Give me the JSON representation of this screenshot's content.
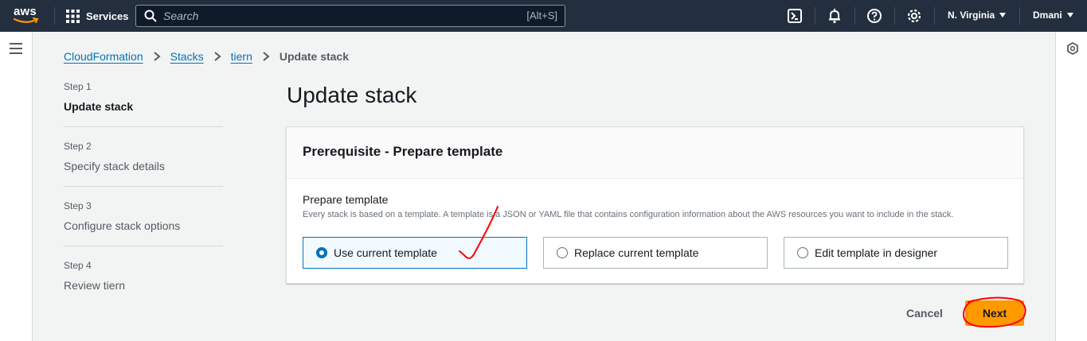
{
  "topnav": {
    "logo_text": "aws",
    "services_label": "Services",
    "search_placeholder": "Search",
    "search_shortcut": "[Alt+S]",
    "region": "N. Virginia",
    "user": "Dmani"
  },
  "breadcrumb": {
    "items": [
      "CloudFormation",
      "Stacks",
      "tiern"
    ],
    "current": "Update stack"
  },
  "steps": [
    {
      "num": "Step 1",
      "title": "Update stack"
    },
    {
      "num": "Step 2",
      "title": "Specify stack details"
    },
    {
      "num": "Step 3",
      "title": "Configure stack options"
    },
    {
      "num": "Step 4",
      "title": "Review tiern"
    }
  ],
  "page": {
    "title": "Update stack"
  },
  "panel": {
    "title": "Prerequisite - Prepare template",
    "field_label": "Prepare template",
    "field_description": "Every stack is based on a template. A template is a JSON or YAML file that contains configuration information about the AWS resources you want to include in the stack.",
    "options": [
      "Use current template",
      "Replace current template",
      "Edit template in designer"
    ]
  },
  "actions": {
    "cancel": "Cancel",
    "next": "Next"
  },
  "colors": {
    "nav_bg": "#232f3e",
    "link": "#0073bb",
    "primary_button": "#ff9900",
    "annotation_ink": "#ff0000"
  }
}
